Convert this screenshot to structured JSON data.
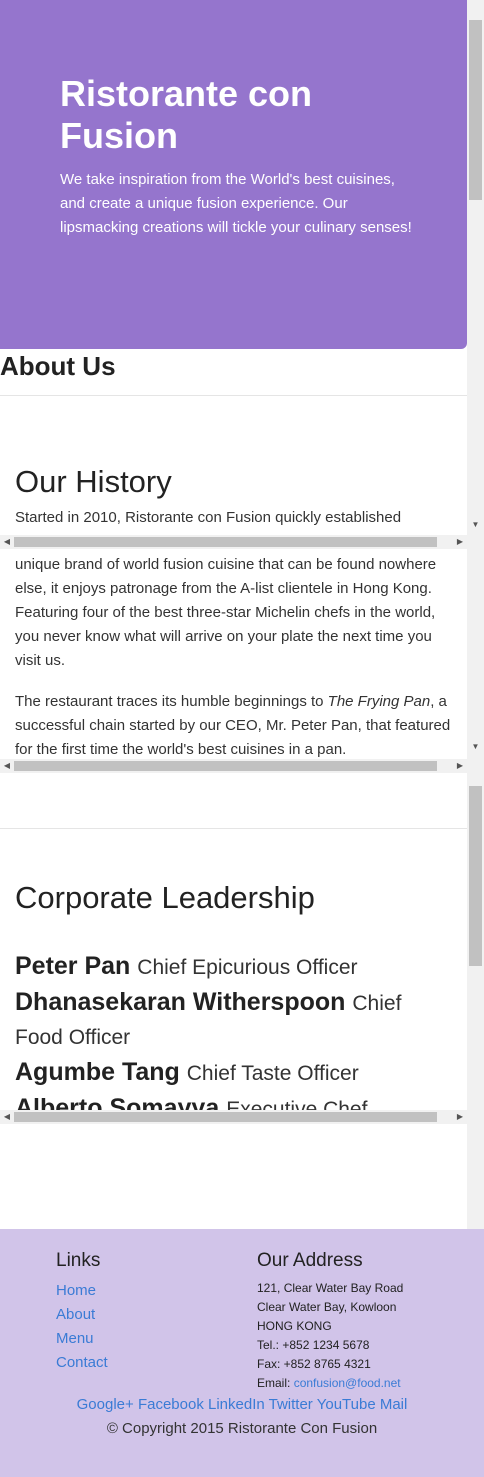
{
  "jumbotron": {
    "title": "Ristorante con Fusion",
    "tagline": "We take inspiration from the World's best cuisines, and create a unique fusion experience. Our lipsmacking creations will tickle your culinary senses!"
  },
  "about": {
    "title": "About Us"
  },
  "history": {
    "title": "Our History",
    "visible_first_line": "Started in 2010, Ristorante con Fusion quickly established",
    "paragraph1_rest": "unique brand of world fusion cuisine that can be found nowhere else, it enjoys patronage from the A-list clientele in Hong Kong. Featuring four of the best three-star Michelin chefs in the world, you never know what will arrive on your plate the next time you visit us.",
    "paragraph2_start": "The restaurant traces its humble beginnings to ",
    "paragraph2_italic": "The Frying Pan",
    "paragraph2_end": ", a successful chain started by our CEO, Mr. Peter Pan, that featured for the first time the world's best cuisines in a pan."
  },
  "leadership": {
    "title": "Corporate Leadership",
    "leaders": [
      {
        "name": "Peter Pan",
        "role": "Chief Epicurious Officer"
      },
      {
        "name": "Dhanasekaran Witherspoon",
        "role": "Chief Food Officer"
      },
      {
        "name": "Agumbe Tang",
        "role": "Chief Taste Officer"
      },
      {
        "name": "Alberto Somayya",
        "role": "Executive Chef"
      }
    ]
  },
  "footer": {
    "links_title": "Links",
    "links": [
      "Home",
      "About",
      "Menu",
      "Contact"
    ],
    "address_title": "Our Address",
    "address_lines": [
      "121, Clear Water Bay Road",
      "Clear Water Bay, Kowloon",
      "HONG KONG",
      "Tel.: +852 1234 5678",
      "Fax: +852 8765 4321"
    ],
    "email_label": "Email: ",
    "email": "confusion@food.net",
    "social": [
      "Google+",
      "Facebook",
      "LinkedIn",
      "Twitter",
      "YouTube",
      "Mail"
    ],
    "copyright": "© Copyright 2015 Ristorante Con Fusion"
  },
  "colors": {
    "jumbotron": "#9575cd",
    "footer": "#d1c4e9",
    "link": "#3a7bd5"
  },
  "icons": [
    "scroll-up-arrow-icon",
    "scroll-down-arrow-icon",
    "scroll-left-arrow-icon",
    "scroll-right-arrow-icon"
  ]
}
